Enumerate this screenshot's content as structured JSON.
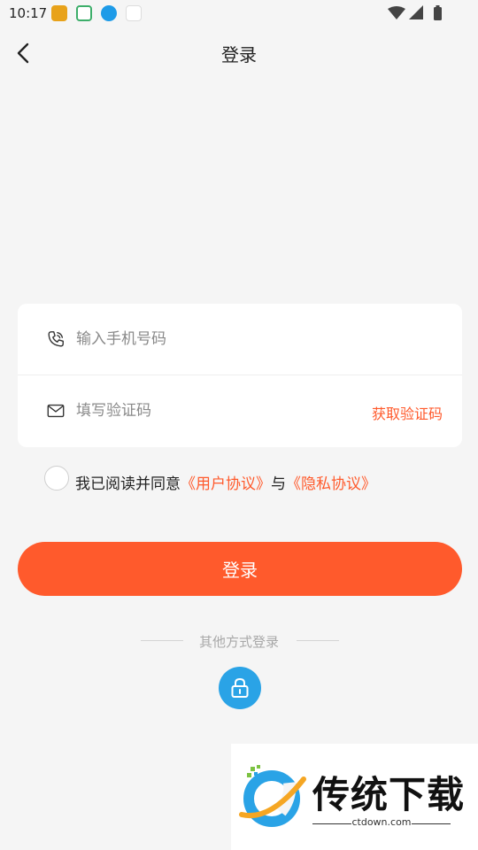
{
  "status_bar": {
    "time": "10:17"
  },
  "header": {
    "title": "登录"
  },
  "form": {
    "phone_placeholder": "输入手机号码",
    "code_placeholder": "填写验证码",
    "get_code_label": "获取验证码"
  },
  "agreement": {
    "prefix": "我已阅读并同意",
    "user_agreement": "《用户协议》",
    "conjunction": "与",
    "privacy_policy": "《隐私协议》",
    "checked": false
  },
  "login_button": {
    "label": "登录"
  },
  "other_login": {
    "label": "其他方式登录"
  },
  "watermark": {
    "title": "传统下载",
    "url": "ctdown.com"
  },
  "colors": {
    "accent": "#ff5a2c",
    "lock_button": "#2aa3e6",
    "background": "#f5f5f5"
  }
}
